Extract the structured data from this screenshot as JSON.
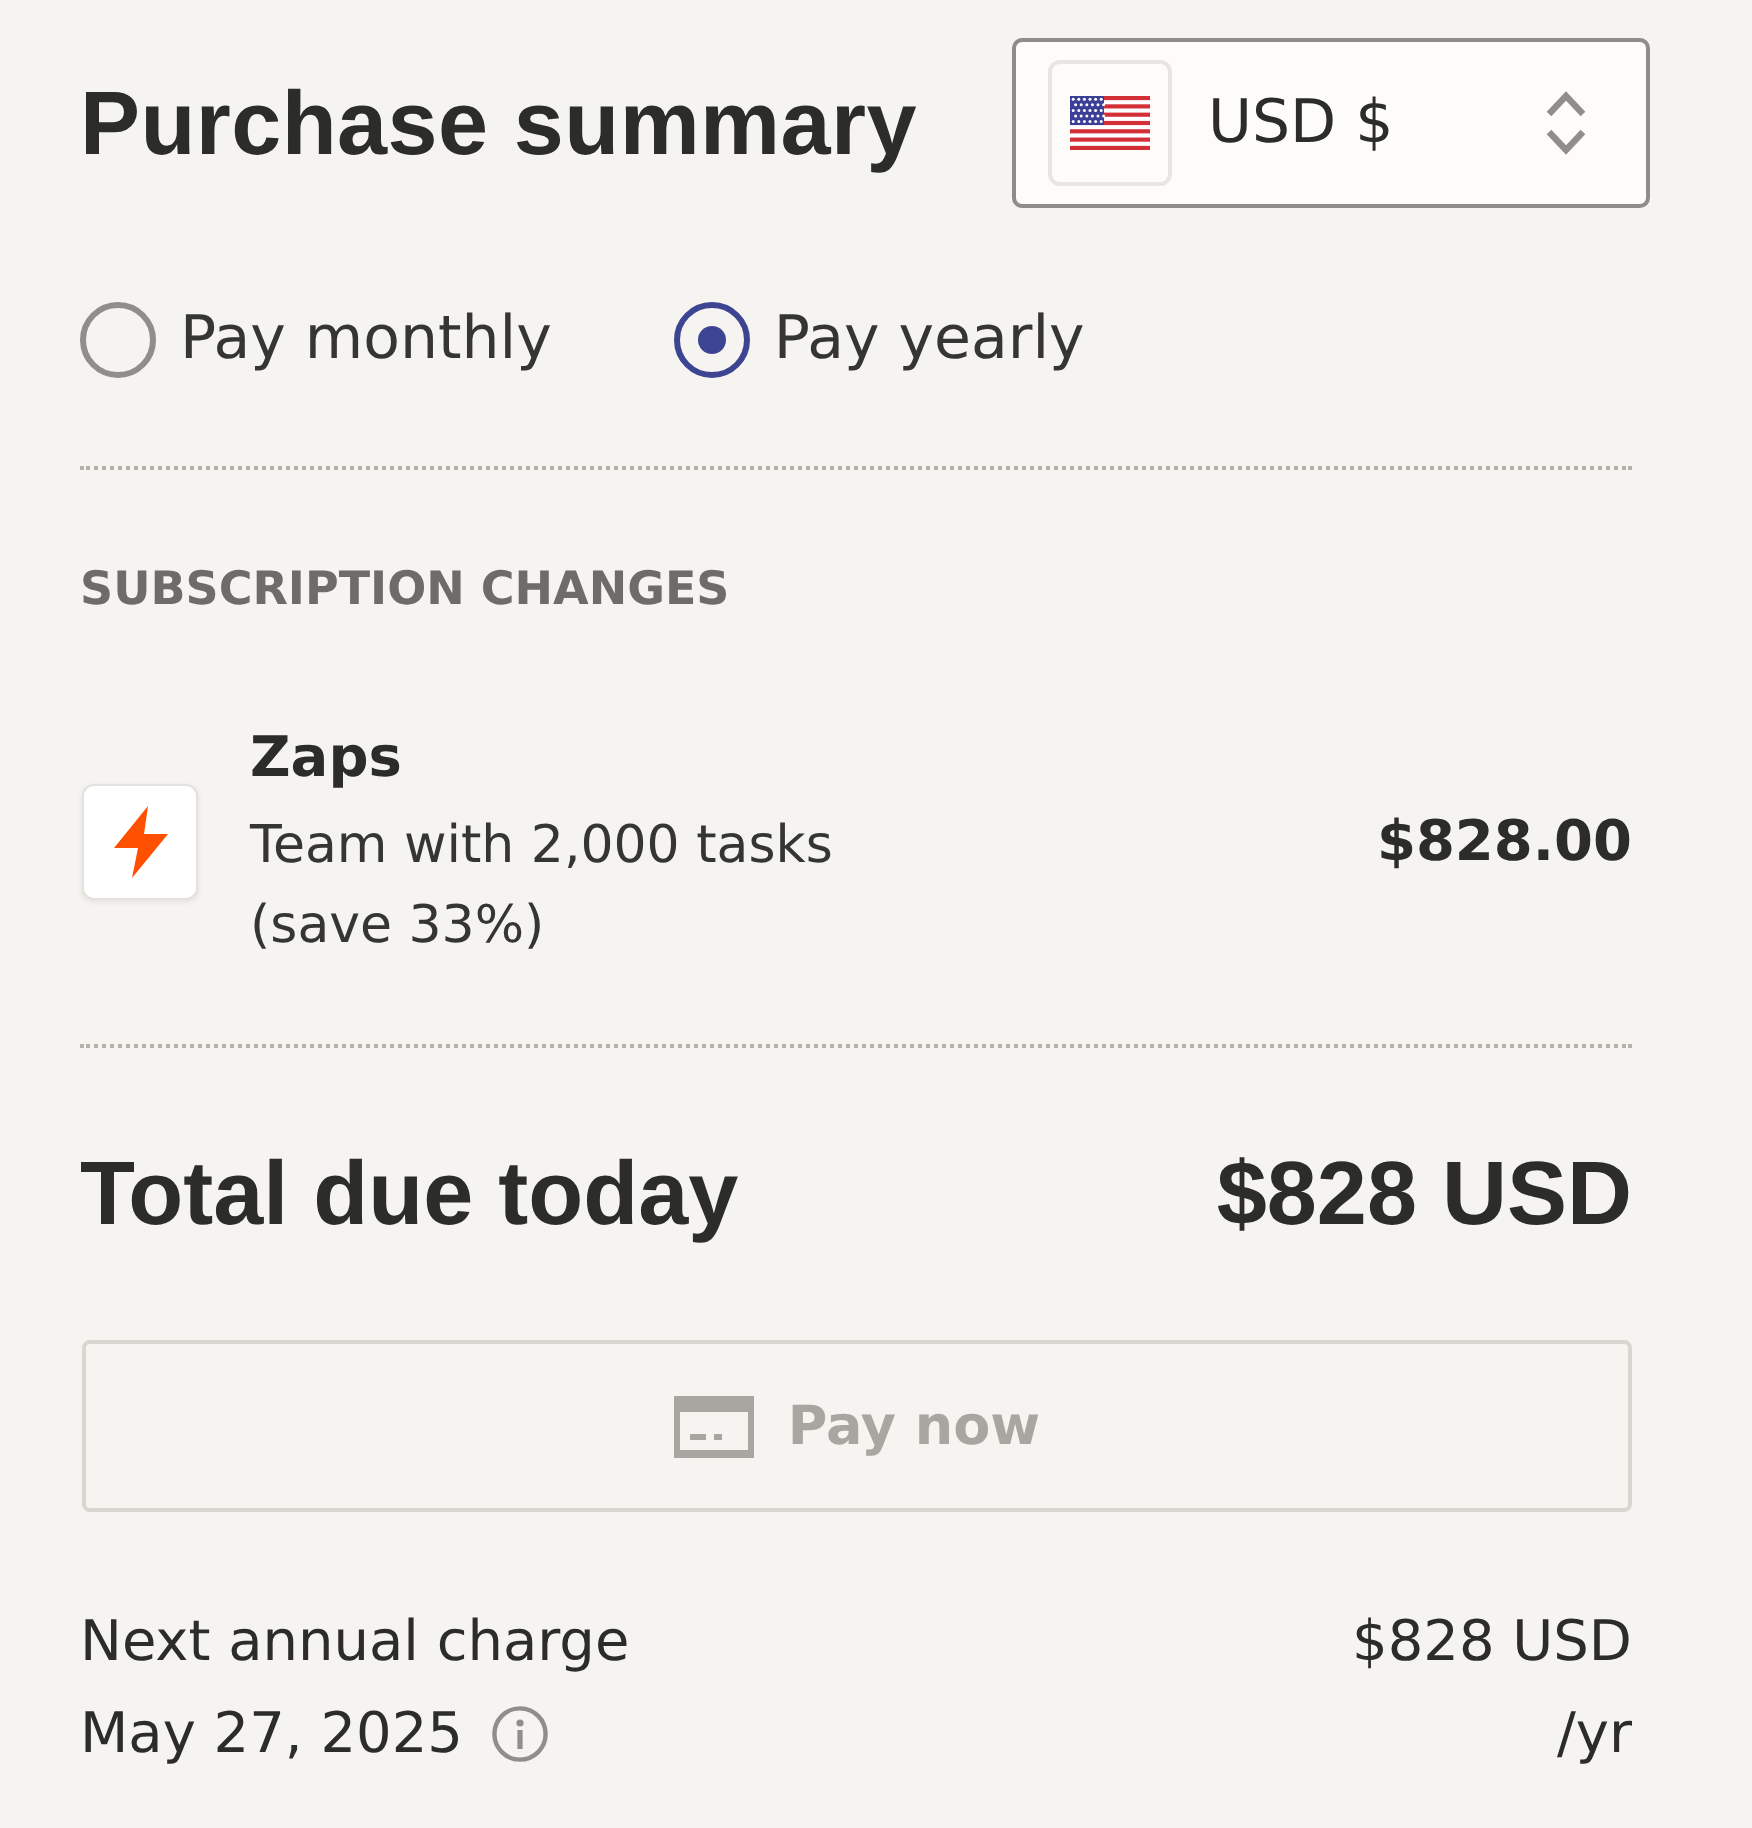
{
  "header": {
    "title": "Purchase summary",
    "currency": {
      "value": "USD $"
    }
  },
  "billing_options": [
    {
      "label": "Pay monthly",
      "selected": false
    },
    {
      "label": "Pay yearly",
      "selected": true
    }
  ],
  "subscription_changes": {
    "heading": "SUBSCRIPTION CHANGES",
    "items": [
      {
        "name": "Zaps",
        "description": "Team with 2,000 tasks",
        "note": "(save 33%)",
        "price": "$828.00"
      }
    ]
  },
  "total": {
    "label": "Total due today",
    "amount": "$828 USD"
  },
  "pay_button": {
    "label": "Pay now",
    "disabled": true
  },
  "next_charge": {
    "label": "Next annual charge",
    "date": "May 27, 2025",
    "amount": "$828 USD",
    "period": "/yr"
  }
}
